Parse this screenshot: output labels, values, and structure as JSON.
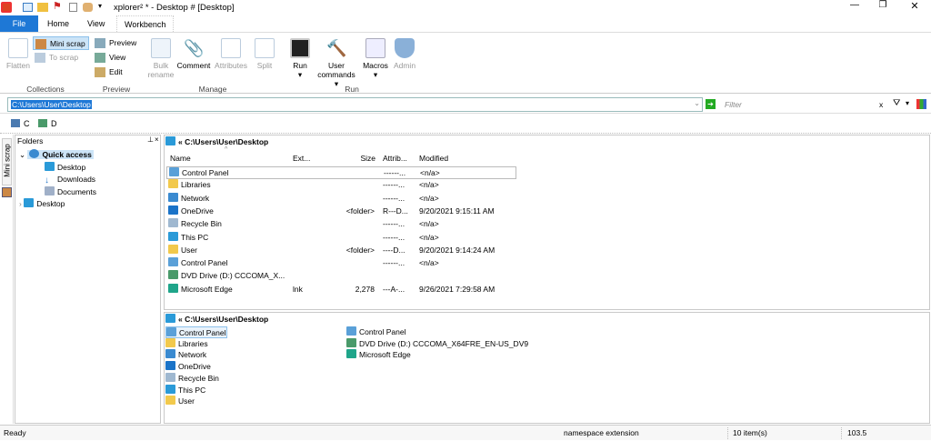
{
  "window": {
    "title": "xplorer² * - Desktop # [Desktop]"
  },
  "menu_tabs": [
    "File",
    "Home",
    "View",
    "Workbench"
  ],
  "ribbon": {
    "collections": {
      "label": "Collections",
      "flatten": "Flatten",
      "mini_scrap": "Mini scrap",
      "to_scrap": "To scrap"
    },
    "preview": {
      "label": "Preview",
      "preview": "Preview",
      "view": "View",
      "edit": "Edit"
    },
    "manage": {
      "label": "Manage",
      "bulk_rename_1": "Bulk",
      "bulk_rename_2": "rename",
      "comment": "Comment",
      "attributes": "Attributes",
      "split": "Split"
    },
    "run": {
      "label": "Run",
      "run": "Run",
      "user_commands_1": "User",
      "user_commands_2": "commands",
      "macros": "Macros",
      "admin": "Admin"
    }
  },
  "address": {
    "value": "C:\\Users\\User\\Desktop",
    "filter_placeholder": "Filter",
    "clear": "x"
  },
  "drives": [
    "C",
    "D"
  ],
  "folders": {
    "title": "Folders",
    "mini_scrap_tab": "Mini scrap",
    "items": [
      {
        "label": "Quick access"
      },
      {
        "label": "Desktop"
      },
      {
        "label": "Downloads"
      },
      {
        "label": "Documents"
      },
      {
        "label": "Desktop"
      }
    ]
  },
  "top_pane": {
    "path": "« C:\\Users\\User\\Desktop",
    "columns": {
      "name": "Name",
      "ext": "Ext...",
      "size": "Size",
      "attrib": "Attrib...",
      "modified": "Modified"
    },
    "rows": [
      {
        "name": "Control Panel",
        "ext": "",
        "size": "",
        "attrib": "------...",
        "modified": "<n/a>",
        "color": "#5aa0d8"
      },
      {
        "name": "Libraries",
        "ext": "",
        "size": "",
        "attrib": "------...",
        "modified": "<n/a>",
        "color": "#f2c94c"
      },
      {
        "name": "Network",
        "ext": "",
        "size": "",
        "attrib": "------...",
        "modified": "<n/a>",
        "color": "#3a8ad0"
      },
      {
        "name": "OneDrive",
        "ext": "",
        "size": "<folder>",
        "attrib": "R---D...",
        "modified": "9/20/2021 9:15:11 AM",
        "color": "#1a73c8"
      },
      {
        "name": "Recycle Bin",
        "ext": "",
        "size": "",
        "attrib": "------...",
        "modified": "<n/a>",
        "color": "#9fb8d0"
      },
      {
        "name": "This PC",
        "ext": "",
        "size": "",
        "attrib": "------...",
        "modified": "<n/a>",
        "color": "#2a9ad8"
      },
      {
        "name": "User",
        "ext": "",
        "size": "<folder>",
        "attrib": "----D...",
        "modified": "9/20/2021 9:14:24 AM",
        "color": "#f2c94c"
      },
      {
        "name": "Control Panel",
        "ext": "",
        "size": "",
        "attrib": "------...",
        "modified": "<n/a>",
        "color": "#5aa0d8"
      },
      {
        "name": "DVD Drive (D:) CCCOMA_X...",
        "ext": "",
        "size": "",
        "attrib": "",
        "modified": "",
        "color": "#4a9a6a"
      },
      {
        "name": "Microsoft Edge",
        "ext": "lnk",
        "size": "2,278",
        "attrib": "---A-...",
        "modified": "9/26/2021 7:29:58 AM",
        "color": "#1fa58a"
      }
    ]
  },
  "bottom_pane": {
    "path": "« C:\\Users\\User\\Desktop",
    "col1": [
      {
        "name": "Control Panel",
        "color": "#5aa0d8"
      },
      {
        "name": "Libraries",
        "color": "#f2c94c"
      },
      {
        "name": "Network",
        "color": "#3a8ad0"
      },
      {
        "name": "OneDrive",
        "color": "#1a73c8"
      },
      {
        "name": "Recycle Bin",
        "color": "#9fb8d0"
      },
      {
        "name": "This PC",
        "color": "#2a9ad8"
      },
      {
        "name": "User",
        "color": "#f2c94c"
      }
    ],
    "col2": [
      {
        "name": "Control Panel",
        "color": "#5aa0d8"
      },
      {
        "name": "DVD Drive (D:) CCCOMA_X64FRE_EN-US_DV9",
        "color": "#4a9a6a"
      },
      {
        "name": "Microsoft Edge",
        "color": "#1fa58a"
      }
    ]
  },
  "status": {
    "ready": "Ready",
    "type": "namespace extension",
    "count": "10 item(s)",
    "free": "103.5"
  },
  "colors": {
    "accent": "#1e78d6",
    "selection": "#cce4f7"
  }
}
